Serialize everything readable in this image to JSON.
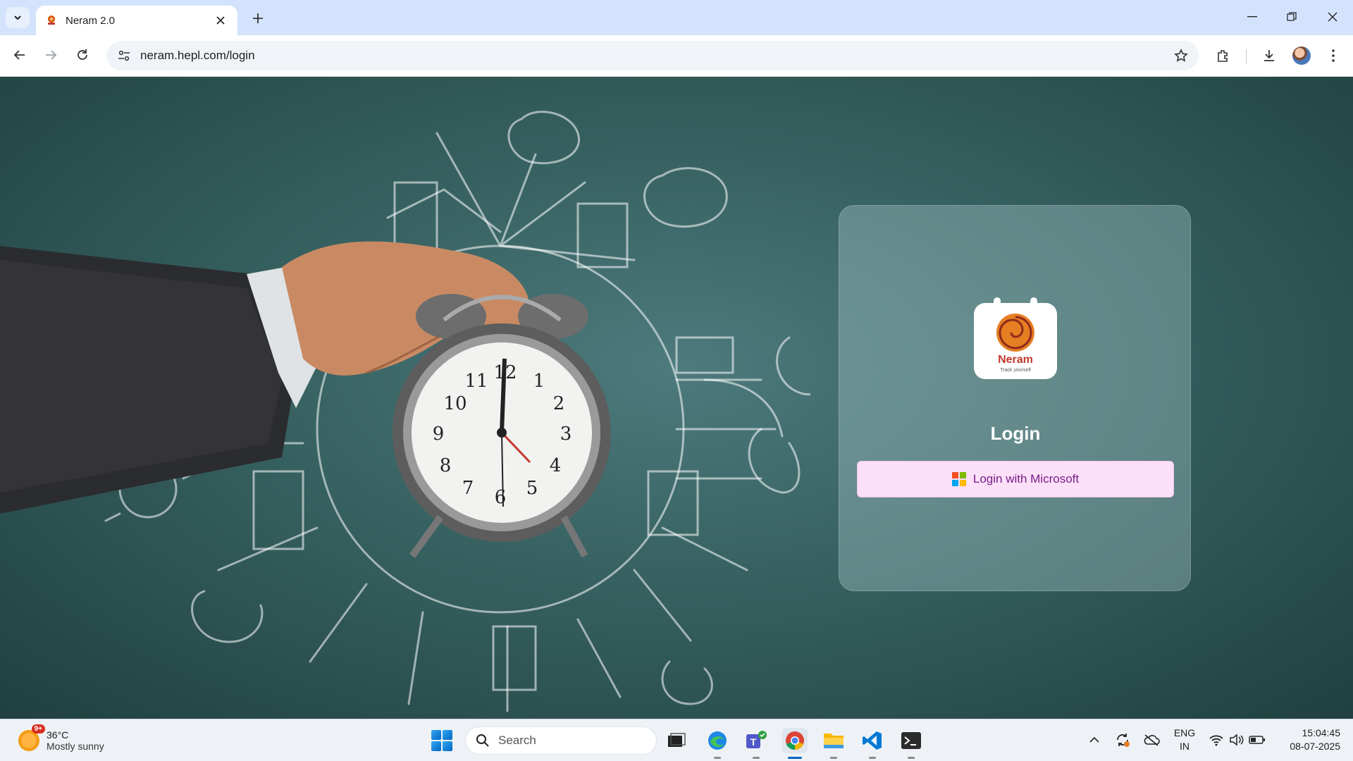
{
  "browser": {
    "tab_title": "Neram 2.0",
    "url": "neram.hepl.com/login",
    "icons": [
      "tab-search-icon",
      "favicon-icon",
      "close-icon",
      "new-tab-icon",
      "minimize-icon",
      "restore-icon",
      "window-close-icon",
      "back-icon",
      "forward-icon",
      "reload-icon",
      "site-info-icon",
      "bookmark-star-icon",
      "extensions-icon",
      "download-icon",
      "profile-avatar",
      "menu-icon"
    ]
  },
  "login": {
    "logo_text": "Neram",
    "logo_tagline": "Track yourself",
    "title": "Login",
    "microsoft_button_label": "Login with Microsoft"
  },
  "taskbar": {
    "weather_badge": "9+",
    "weather_temp": "36°C",
    "weather_desc": "Mostly sunny",
    "search_label": "Search",
    "lang_line1": "ENG",
    "lang_line2": "IN",
    "time": "15:04:45",
    "date": "08-07-2025",
    "apps": [
      "file-explorer-dark",
      "edge",
      "teams",
      "chrome",
      "file-explorer",
      "vscode",
      "terminal"
    ]
  },
  "colors": {
    "chrome_tabstrip": "#d3e3fd",
    "page_bg": "#36605f",
    "ms_button_bg": "#fbe0f8",
    "ms_button_text": "#7a1c8a",
    "logo_red": "#c0392b",
    "ms_red": "#f25022",
    "ms_green": "#7fba00",
    "ms_blue": "#00a4ef",
    "ms_yellow": "#ffb900"
  }
}
